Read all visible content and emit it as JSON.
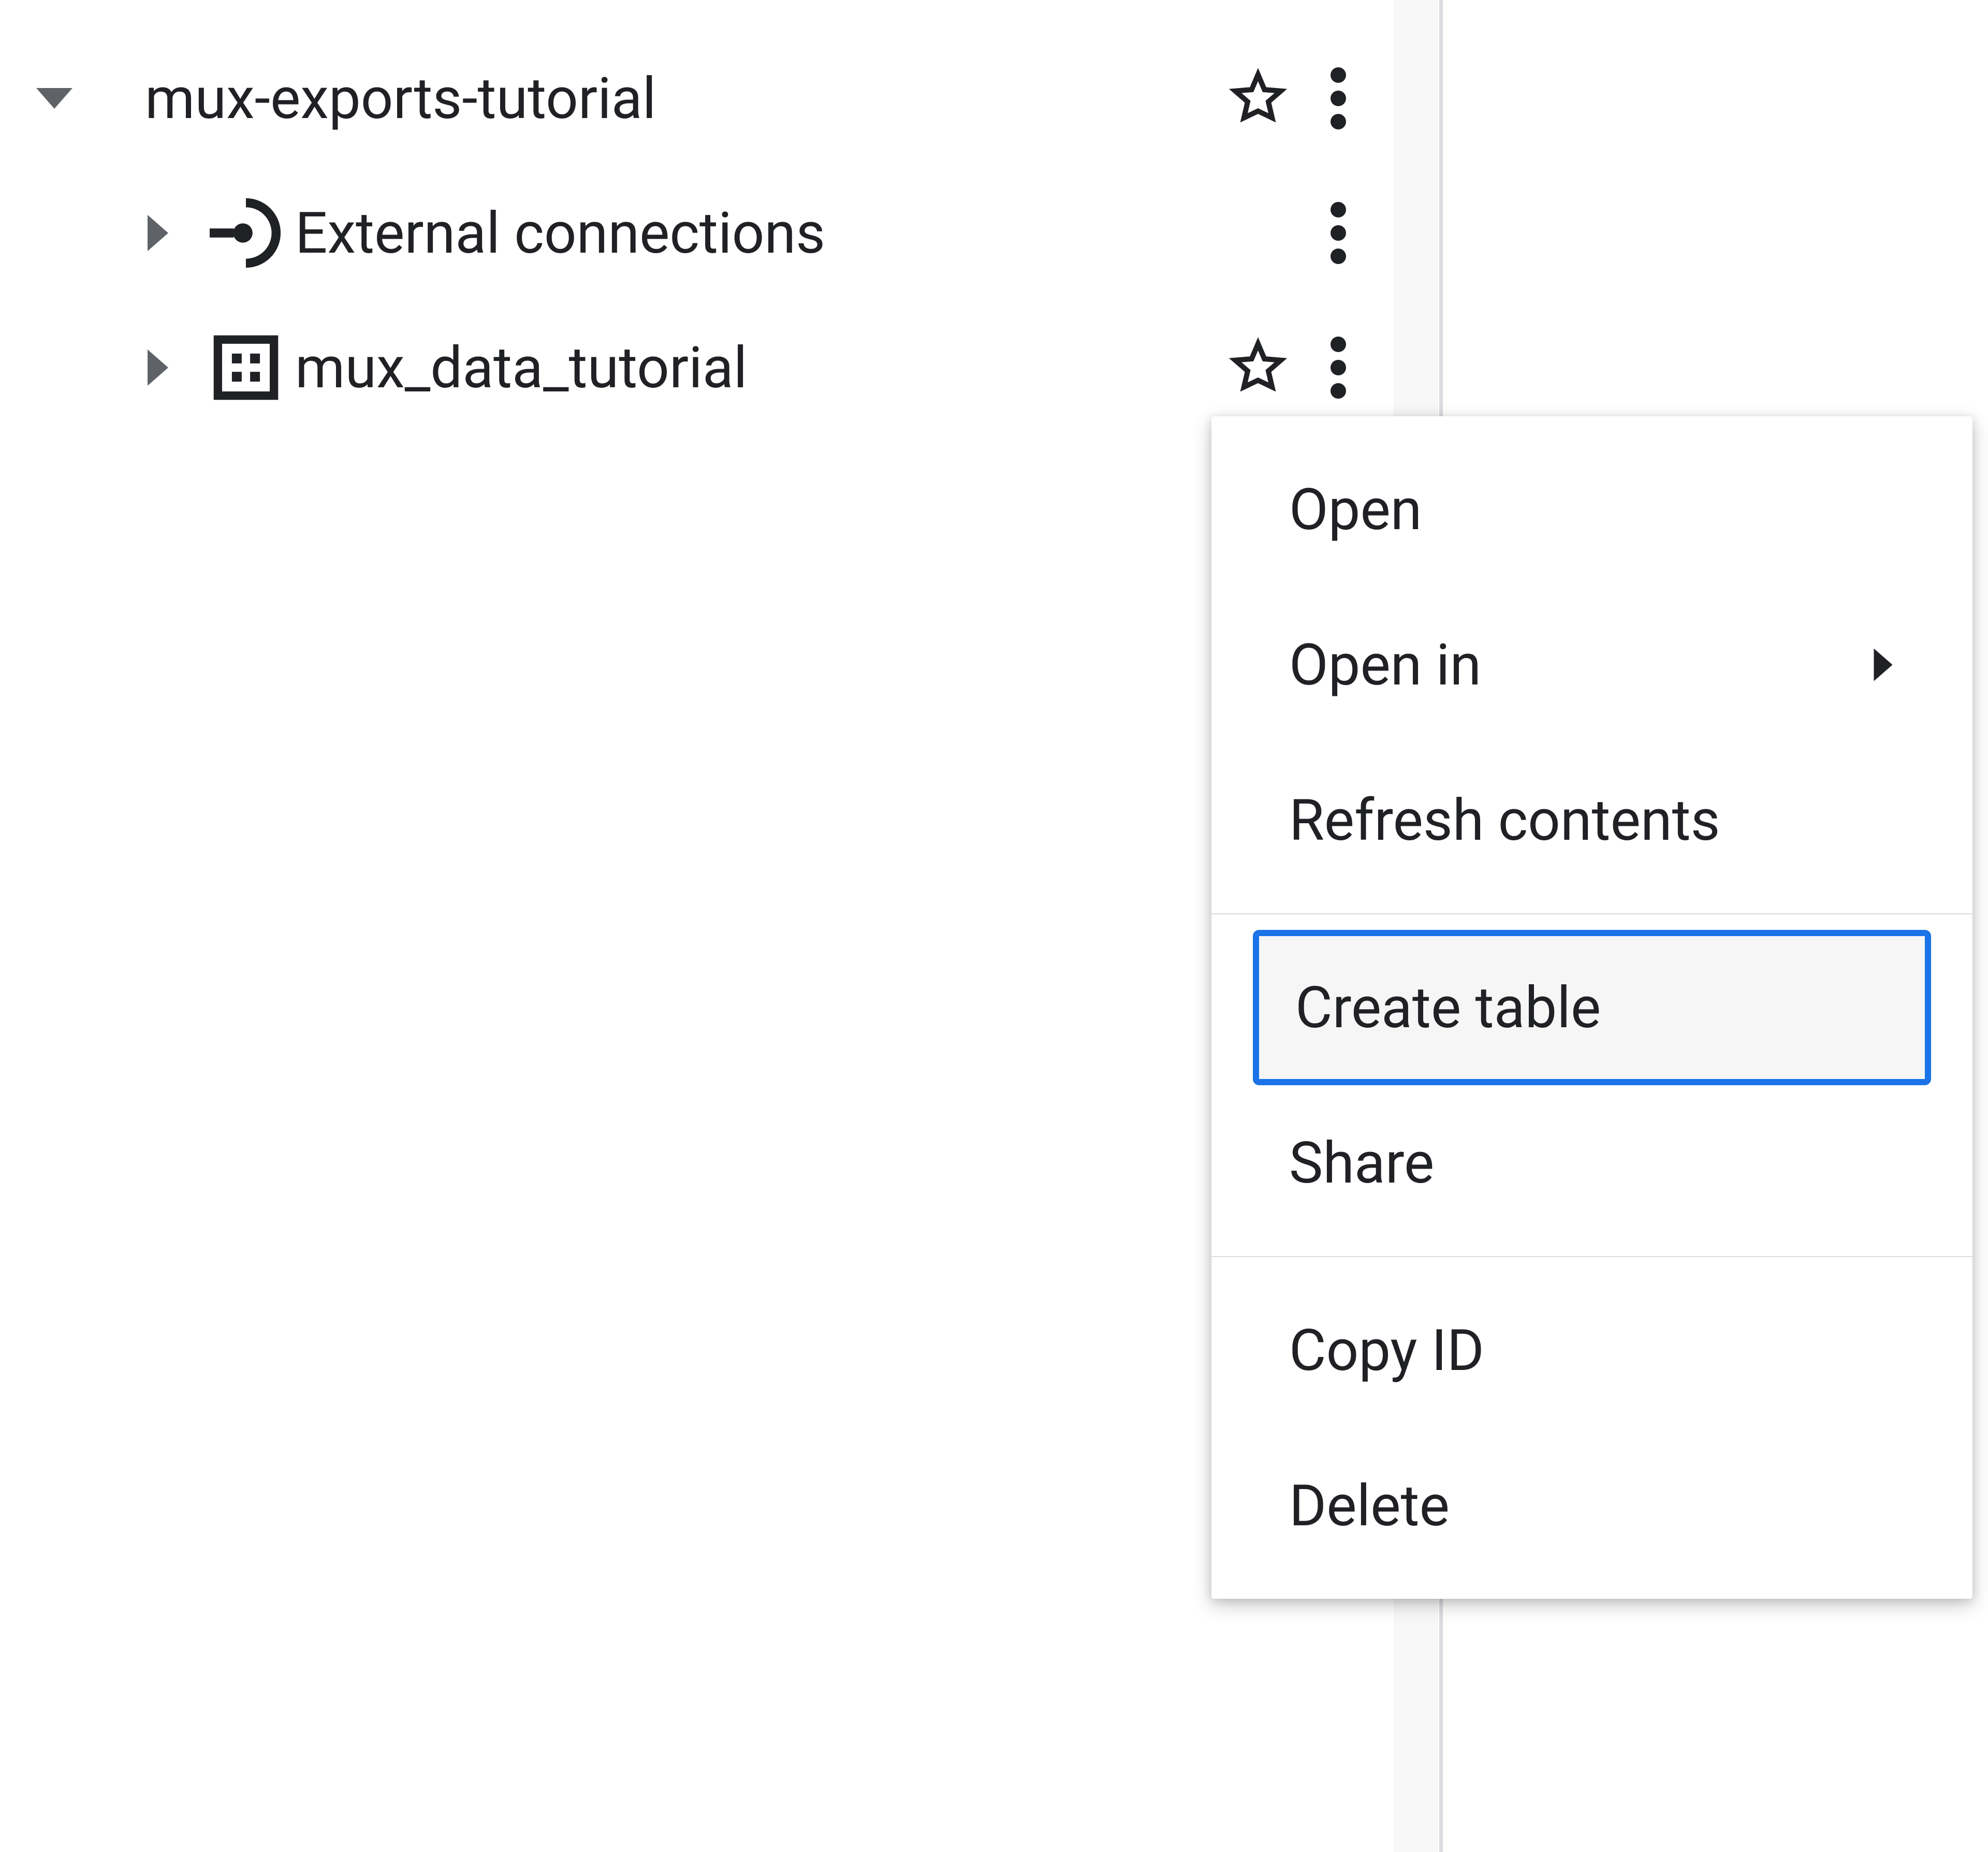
{
  "tree": {
    "project": {
      "label": "mux-exports-tutorial"
    },
    "children": [
      {
        "label": "External connections"
      },
      {
        "label": "mux_data_tutorial"
      }
    ]
  },
  "context_menu": {
    "groups": [
      [
        {
          "id": "open",
          "label": "Open",
          "submenu": false,
          "highlighted": false
        },
        {
          "id": "open_in",
          "label": "Open in",
          "submenu": true,
          "highlighted": false
        },
        {
          "id": "refresh_contents",
          "label": "Refresh contents",
          "submenu": false,
          "highlighted": false
        }
      ],
      [
        {
          "id": "create_table",
          "label": "Create table",
          "submenu": false,
          "highlighted": true
        },
        {
          "id": "share",
          "label": "Share",
          "submenu": false,
          "highlighted": false
        }
      ],
      [
        {
          "id": "copy_id",
          "label": "Copy ID",
          "submenu": false,
          "highlighted": false
        },
        {
          "id": "delete",
          "label": "Delete",
          "submenu": false,
          "highlighted": false
        }
      ]
    ]
  }
}
